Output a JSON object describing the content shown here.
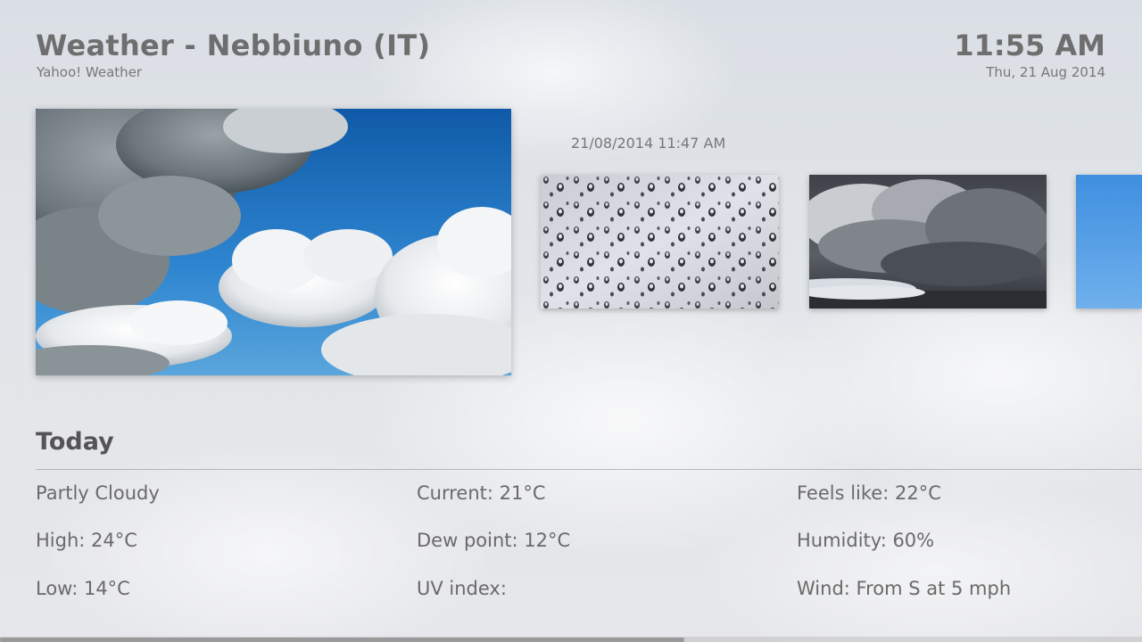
{
  "header": {
    "title": "Weather - Nebbiuno (IT)",
    "provider": "Yahoo! Weather",
    "time": "11:55 AM",
    "date": "Thu, 21 Aug 2014"
  },
  "gallery": {
    "timestamp": "21/08/2014 11:47 AM",
    "images": [
      {
        "name": "blue-sky-clouds-image"
      },
      {
        "name": "raindrops-image"
      },
      {
        "name": "storm-clouds-image"
      },
      {
        "name": "blue-sky-image"
      }
    ]
  },
  "today": {
    "heading": "Today",
    "condition": "Partly Cloudy",
    "high": "High: 24°C",
    "low": "Low: 14°C",
    "current": "Current: 21°C",
    "dew_point": "Dew point: 12°C",
    "uv_index": "UV index:",
    "feels_like": "Feels like: 22°C",
    "humidity": "Humidity: 60%",
    "wind": "Wind: From S at 5 mph"
  },
  "colors": {
    "sky_blue": "#1f6fc0",
    "text_gray": "#6e6e6e"
  }
}
